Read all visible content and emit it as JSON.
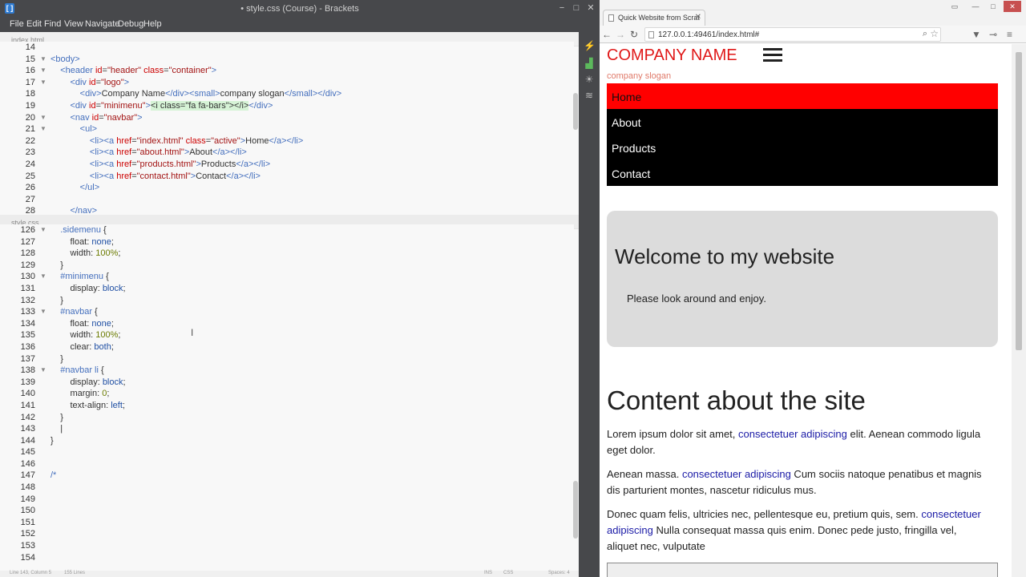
{
  "brackets": {
    "window_title": "• style.css (Course) - Brackets",
    "menu": [
      "File",
      "Edit",
      "Find",
      "View",
      "Navigate",
      "Debug",
      "Help"
    ],
    "html_pane": {
      "filename": "index.html",
      "lines": [
        {
          "n": "14",
          "fold": false,
          "parts": []
        },
        {
          "n": "15",
          "fold": true,
          "parts": [
            [
              "tag",
              "<body>"
            ]
          ]
        },
        {
          "n": "16",
          "fold": true,
          "parts": [
            [
              "tag",
              "    <header "
            ],
            [
              "attr",
              "id"
            ],
            [
              "txt",
              "="
            ],
            [
              "str",
              "\"header\""
            ],
            [
              "txt",
              " "
            ],
            [
              "attr",
              "class"
            ],
            [
              "txt",
              "="
            ],
            [
              "str",
              "\"container\""
            ],
            [
              "tag",
              ">"
            ]
          ]
        },
        {
          "n": "17",
          "fold": true,
          "parts": [
            [
              "tag",
              "        <div "
            ],
            [
              "attr",
              "id"
            ],
            [
              "txt",
              "="
            ],
            [
              "str",
              "\"logo\""
            ],
            [
              "tag",
              ">"
            ]
          ]
        },
        {
          "n": "18",
          "fold": false,
          "parts": [
            [
              "tag",
              "            <div>"
            ],
            [
              "txt",
              "Company Name"
            ],
            [
              "tag",
              "</div><small>"
            ],
            [
              "txt",
              "company slogan"
            ],
            [
              "tag",
              "</small></div>"
            ]
          ]
        },
        {
          "n": "19",
          "fold": false,
          "parts": [
            [
              "tag",
              "        <div "
            ],
            [
              "attr",
              "id"
            ],
            [
              "txt",
              "="
            ],
            [
              "str",
              "\"minimenu\""
            ],
            [
              "tag",
              ">"
            ],
            [
              "hl",
              "<i class=\"fa fa-bars\"></i>"
            ],
            [
              "tag",
              "</div>"
            ]
          ]
        },
        {
          "n": "20",
          "fold": true,
          "parts": [
            [
              "tag",
              "        <nav "
            ],
            [
              "attr",
              "id"
            ],
            [
              "txt",
              "="
            ],
            [
              "str",
              "\"navbar\""
            ],
            [
              "tag",
              ">"
            ]
          ]
        },
        {
          "n": "21",
          "fold": true,
          "parts": [
            [
              "tag",
              "            <ul>"
            ]
          ]
        },
        {
          "n": "22",
          "fold": false,
          "parts": [
            [
              "tag",
              "                <li><a "
            ],
            [
              "attr",
              "href"
            ],
            [
              "txt",
              "="
            ],
            [
              "str",
              "\"index.html\""
            ],
            [
              "txt",
              " "
            ],
            [
              "attr",
              "class"
            ],
            [
              "txt",
              "="
            ],
            [
              "str",
              "\"active\""
            ],
            [
              "tag",
              ">"
            ],
            [
              "txt",
              "Home"
            ],
            [
              "tag",
              "</a></li>"
            ]
          ]
        },
        {
          "n": "23",
          "fold": false,
          "parts": [
            [
              "tag",
              "                <li><a "
            ],
            [
              "attr",
              "href"
            ],
            [
              "txt",
              "="
            ],
            [
              "str",
              "\"about.html\""
            ],
            [
              "tag",
              ">"
            ],
            [
              "txt",
              "About"
            ],
            [
              "tag",
              "</a></li>"
            ]
          ]
        },
        {
          "n": "24",
          "fold": false,
          "parts": [
            [
              "tag",
              "                <li><a "
            ],
            [
              "attr",
              "href"
            ],
            [
              "txt",
              "="
            ],
            [
              "str",
              "\"products.html\""
            ],
            [
              "tag",
              ">"
            ],
            [
              "txt",
              "Products"
            ],
            [
              "tag",
              "</a></li>"
            ]
          ]
        },
        {
          "n": "25",
          "fold": false,
          "parts": [
            [
              "tag",
              "                <li><a "
            ],
            [
              "attr",
              "href"
            ],
            [
              "txt",
              "="
            ],
            [
              "str",
              "\"contact.html\""
            ],
            [
              "tag",
              ">"
            ],
            [
              "txt",
              "Contact"
            ],
            [
              "tag",
              "</a></li>"
            ]
          ]
        },
        {
          "n": "26",
          "fold": false,
          "parts": [
            [
              "tag",
              "            </ul>"
            ]
          ]
        },
        {
          "n": "27",
          "fold": false,
          "parts": []
        },
        {
          "n": "28",
          "fold": false,
          "parts": [
            [
              "tag",
              "        </nav>"
            ]
          ]
        }
      ]
    },
    "css_pane": {
      "filename": "style.css",
      "lines": [
        {
          "n": "126",
          "fold": true,
          "parts": [
            [
              "sel",
              "    .sidemenu "
            ],
            [
              "txt",
              "{"
            ]
          ]
        },
        {
          "n": "127",
          "fold": false,
          "parts": [
            [
              "txt",
              "        float: "
            ],
            [
              "kw",
              "none"
            ],
            [
              "txt",
              ";"
            ]
          ]
        },
        {
          "n": "128",
          "fold": false,
          "parts": [
            [
              "txt",
              "        width: "
            ],
            [
              "num",
              "100%"
            ],
            [
              "txt",
              ";"
            ]
          ]
        },
        {
          "n": "129",
          "fold": false,
          "parts": [
            [
              "txt",
              "    }"
            ]
          ]
        },
        {
          "n": "130",
          "fold": true,
          "parts": [
            [
              "sel",
              "    #minimenu "
            ],
            [
              "txt",
              "{"
            ]
          ]
        },
        {
          "n": "131",
          "fold": false,
          "parts": [
            [
              "txt",
              "        display: "
            ],
            [
              "kw",
              "block"
            ],
            [
              "txt",
              ";"
            ]
          ]
        },
        {
          "n": "132",
          "fold": false,
          "parts": [
            [
              "txt",
              "    }"
            ]
          ]
        },
        {
          "n": "133",
          "fold": true,
          "parts": [
            [
              "sel",
              "    #navbar "
            ],
            [
              "txt",
              "{"
            ]
          ]
        },
        {
          "n": "134",
          "fold": false,
          "parts": [
            [
              "txt",
              "        float: "
            ],
            [
              "kw",
              "none"
            ],
            [
              "txt",
              ";"
            ]
          ]
        },
        {
          "n": "135",
          "fold": false,
          "parts": [
            [
              "txt",
              "        width: "
            ],
            [
              "num",
              "100%"
            ],
            [
              "txt",
              ";"
            ]
          ]
        },
        {
          "n": "136",
          "fold": false,
          "parts": [
            [
              "txt",
              "        clear: "
            ],
            [
              "kw",
              "both"
            ],
            [
              "txt",
              ";"
            ]
          ]
        },
        {
          "n": "137",
          "fold": false,
          "parts": [
            [
              "txt",
              "    }"
            ]
          ]
        },
        {
          "n": "138",
          "fold": true,
          "parts": [
            [
              "sel",
              "    #navbar li "
            ],
            [
              "txt",
              "{"
            ]
          ]
        },
        {
          "n": "139",
          "fold": false,
          "parts": [
            [
              "txt",
              "        display: "
            ],
            [
              "kw",
              "block"
            ],
            [
              "txt",
              ";"
            ]
          ]
        },
        {
          "n": "140",
          "fold": false,
          "parts": [
            [
              "txt",
              "        margin: "
            ],
            [
              "num",
              "0"
            ],
            [
              "txt",
              ";"
            ]
          ]
        },
        {
          "n": "141",
          "fold": false,
          "parts": [
            [
              "txt",
              "        text-align: "
            ],
            [
              "kw",
              "left"
            ],
            [
              "txt",
              ";"
            ]
          ]
        },
        {
          "n": "142",
          "fold": false,
          "parts": [
            [
              "txt",
              "    }"
            ]
          ]
        },
        {
          "n": "143",
          "fold": false,
          "parts": [
            [
              "txt",
              "    |"
            ]
          ]
        },
        {
          "n": "144",
          "fold": false,
          "parts": [
            [
              "txt",
              "}"
            ]
          ]
        },
        {
          "n": "145",
          "fold": false,
          "parts": []
        },
        {
          "n": "146",
          "fold": false,
          "parts": []
        },
        {
          "n": "147",
          "fold": false,
          "parts": [
            [
              "com",
              "/*"
            ]
          ]
        },
        {
          "n": "148",
          "fold": false,
          "parts": []
        },
        {
          "n": "149",
          "fold": false,
          "parts": []
        },
        {
          "n": "150",
          "fold": false,
          "parts": []
        },
        {
          "n": "151",
          "fold": false,
          "parts": []
        },
        {
          "n": "152",
          "fold": false,
          "parts": []
        },
        {
          "n": "153",
          "fold": false,
          "parts": []
        },
        {
          "n": "154",
          "fold": false,
          "parts": []
        }
      ]
    },
    "status": {
      "position": "Line 143, Column 5",
      "lines": "155 Lines",
      "ins": "INS",
      "mode": "CSS",
      "spaces": "Spaces: 4"
    }
  },
  "chrome": {
    "tab_title": "Quick Website from Scrat",
    "url": "127.0.0.1:49461/index.html#"
  },
  "site": {
    "company_name": "COMPANY NAME",
    "slogan": "company slogan",
    "nav": [
      "Home",
      "About",
      "Products",
      "Contact"
    ],
    "hero_title": "Welcome to my website",
    "hero_text": "Please look around and enjoy.",
    "content_title": "Content about the site",
    "paragraphs": [
      {
        "before": "Lorem ipsum dolor sit amet, ",
        "link": "consectetuer adipiscing",
        "after": " elit. Aenean commodo ligula eget dolor."
      },
      {
        "before": "Aenean massa. ",
        "link": "consectetuer adipiscing",
        "after": " Cum sociis natoque penatibus et magnis dis parturient montes, nascetur ridiculus mus."
      },
      {
        "before": "Donec quam felis, ultricies nec, pellentesque eu, pretium quis, sem. ",
        "link": "consectetuer adipiscing",
        "after": " Nulla consequat massa quis enim. Donec pede justo, fringilla vel, aliquet nec, vulputate"
      }
    ]
  },
  "colors": {
    "accent_red": "#ff0000",
    "company_red": "#e01818",
    "link_blue": "#1a1aa6"
  }
}
